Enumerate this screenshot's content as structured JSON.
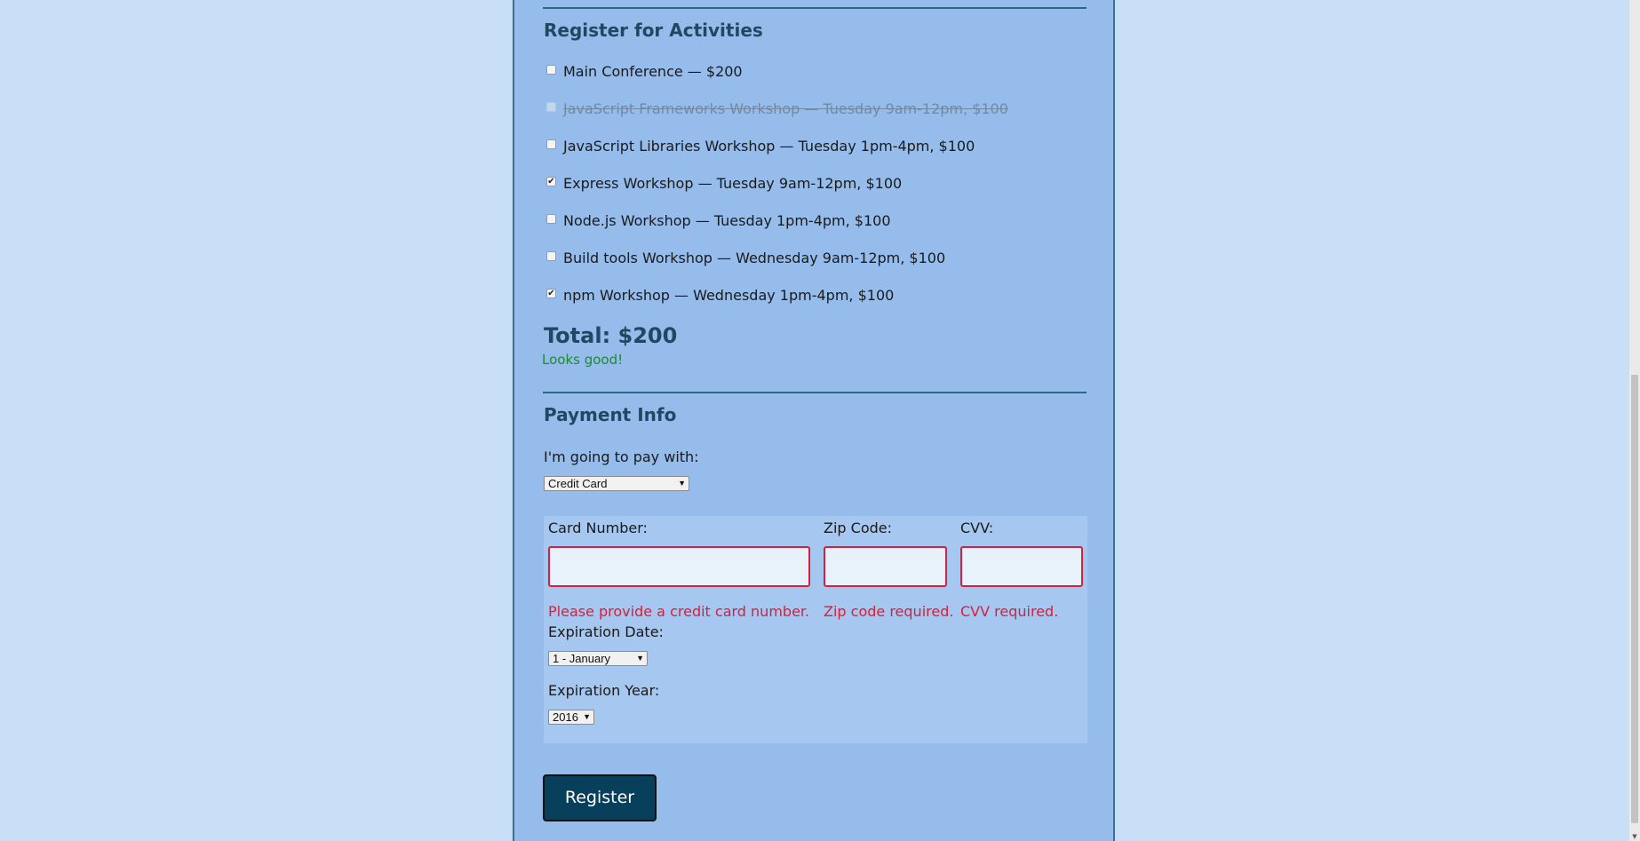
{
  "activities": {
    "title": "Register for Activities",
    "items": [
      {
        "label": "Main Conference — $200",
        "checked": false,
        "disabled": false
      },
      {
        "label": "JavaScript Frameworks Workshop — Tuesday 9am-12pm, $100",
        "checked": false,
        "disabled": true
      },
      {
        "label": "JavaScript Libraries Workshop — Tuesday 1pm-4pm, $100",
        "checked": false,
        "disabled": false
      },
      {
        "label": "Express Workshop — Tuesday 9am-12pm, $100",
        "checked": true,
        "disabled": false
      },
      {
        "label": "Node.js Workshop — Tuesday 1pm-4pm, $100",
        "checked": false,
        "disabled": false
      },
      {
        "label": "Build tools Workshop — Wednesday 9am-12pm, $100",
        "checked": false,
        "disabled": false
      },
      {
        "label": "npm Workshop — Wednesday 1pm-4pm, $100",
        "checked": true,
        "disabled": false
      }
    ],
    "total": "Total: $200",
    "valid_message": "Looks good!"
  },
  "payment": {
    "title": "Payment Info",
    "pay_with_label": "I'm going to pay with:",
    "pay_with_selected": "Credit Card",
    "card_number_label": "Card Number:",
    "zip_label": "Zip Code:",
    "cvv_label": "CVV:",
    "card_number_value": "",
    "zip_value": "",
    "cvv_value": "",
    "card_number_error": "Please provide a credit card number.",
    "zip_error": "Zip code required.",
    "cvv_error": "CVV required.",
    "exp_date_label": "Expiration Date:",
    "exp_date_selected": "1 - January",
    "exp_year_label": "Expiration Year:",
    "exp_year_selected": "2016"
  },
  "register_button": "Register",
  "colors": {
    "page_bg": "#c8dff7",
    "panel_bg": "#96bceb",
    "heading": "#1d4a62",
    "error": "#d4213d",
    "success": "#1d8a2f",
    "button_bg": "#083f5a"
  }
}
